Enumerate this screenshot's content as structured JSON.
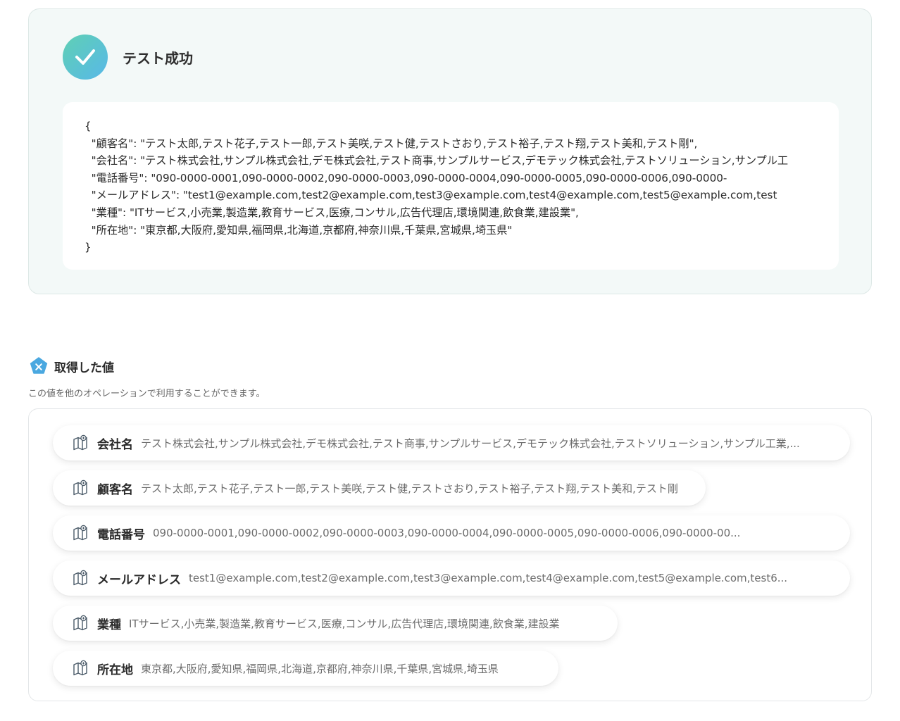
{
  "result": {
    "status_title": "テスト成功",
    "json_lines": [
      "{",
      "  \"顧客名\": \"テスト太郎,テスト花子,テスト一郎,テスト美咲,テスト健,テストさおり,テスト裕子,テスト翔,テスト美和,テスト剛\",",
      "  \"会社名\": \"テスト株式会社,サンプル株式会社,デモ株式会社,テスト商事,サンプルサービス,デモテック株式会社,テストソリューション,サンプル工",
      "  \"電話番号\": \"090-0000-0001,090-0000-0002,090-0000-0003,090-0000-0004,090-0000-0005,090-0000-0006,090-0000-",
      "  \"メールアドレス\": \"test1@example.com,test2@example.com,test3@example.com,test4@example.com,test5@example.com,test",
      "  \"業種\": \"ITサービス,小売業,製造業,教育サービス,医療,コンサル,広告代理店,環境関連,飲食業,建設業\",",
      "  \"所在地\": \"東京都,大阪府,愛知県,福岡県,北海道,京都府,神奈川県,千葉県,宮城県,埼玉県\"",
      "}"
    ]
  },
  "values_section": {
    "title": "取得した値",
    "description": "この値を他のオペレーションで利用することができます。",
    "items": [
      {
        "label": "会社名",
        "value": "テスト株式会社,サンプル株式会社,デモ株式会社,テスト商事,サンプルサービス,デモテック株式会社,テストソリューション,サンプル工業,..."
      },
      {
        "label": "顧客名",
        "value": "テスト太郎,テスト花子,テスト一郎,テスト美咲,テスト健,テストさおり,テスト裕子,テスト翔,テスト美和,テスト剛"
      },
      {
        "label": "電話番号",
        "value": "090-0000-0001,090-0000-0002,090-0000-0003,090-0000-0004,090-0000-0005,090-0000-0006,090-0000-00..."
      },
      {
        "label": "メールアドレス",
        "value": "test1@example.com,test2@example.com,test3@example.com,test4@example.com,test5@example.com,test6..."
      },
      {
        "label": "業種",
        "value": "ITサービス,小売業,製造業,教育サービス,医療,コンサル,広告代理店,環境関連,飲食業,建設業"
      },
      {
        "label": "所在地",
        "value": "東京都,大阪府,愛知県,福岡県,北海道,京都府,神奈川県,千葉県,宮城県,埼玉県"
      }
    ]
  },
  "icons": {
    "success": "check-icon",
    "section": "variable-icon",
    "item": "data-field-icon"
  },
  "colors": {
    "success_gradient_start": "#5fd0b4",
    "success_gradient_end": "#58b8e8",
    "section_icon": "#4aa8e0",
    "panel_background": "#f3f9f8"
  }
}
